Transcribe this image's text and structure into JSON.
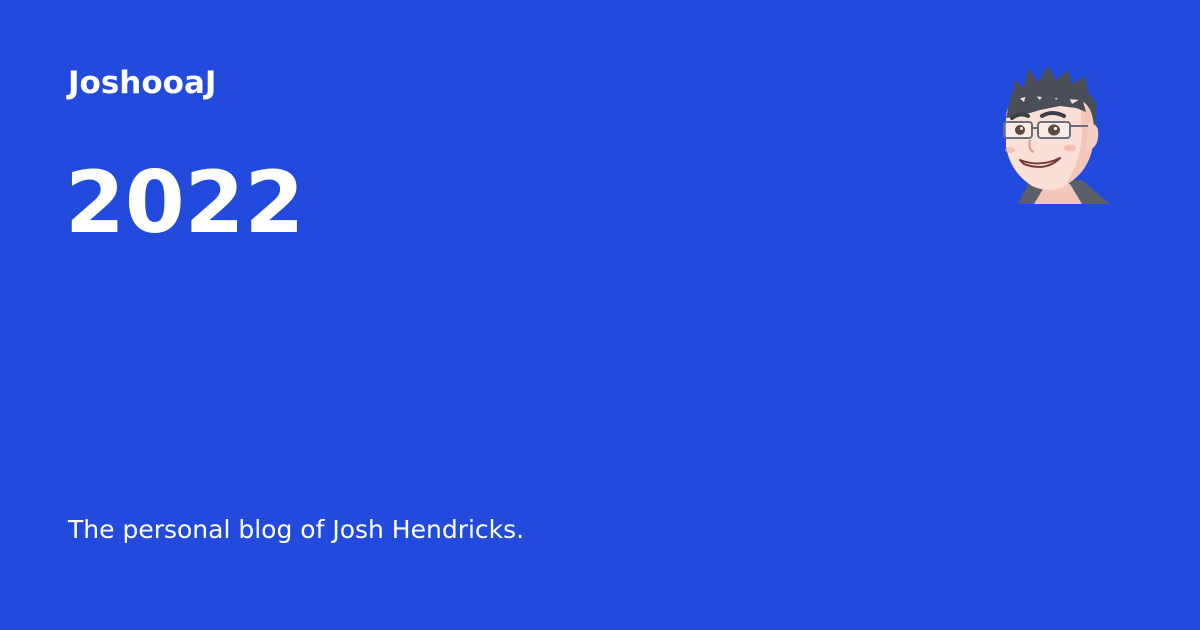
{
  "site": {
    "name": "JoshooaJ",
    "tagline": "The personal blog of Josh Hendricks."
  },
  "page": {
    "title": "2022"
  },
  "avatar": {
    "icon": "cartoon-avatar-icon"
  },
  "colors": {
    "background": "#224bdd",
    "text": "#ffffff"
  }
}
